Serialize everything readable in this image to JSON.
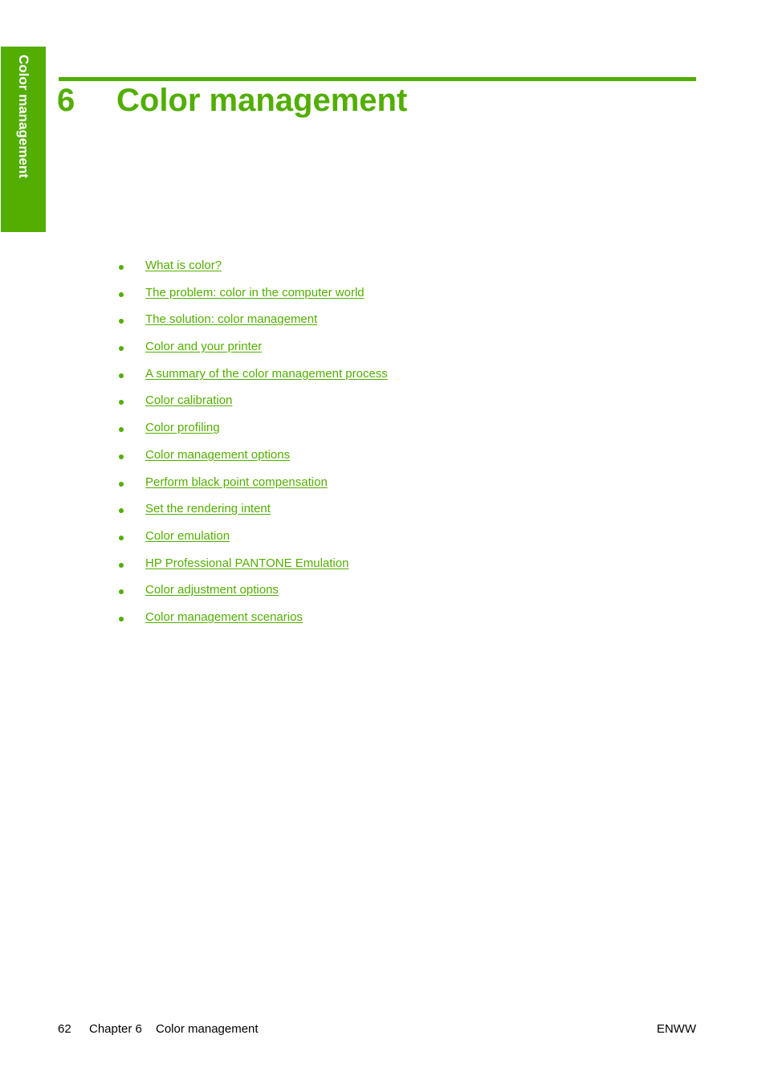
{
  "theme": {
    "accent": "#52ae00",
    "text": "#000000"
  },
  "side_tab": {
    "label": "Color management"
  },
  "header": {
    "chapter_number": "6",
    "chapter_title": "Color management"
  },
  "toc": {
    "items": [
      {
        "label": "What is color?"
      },
      {
        "label": "The problem: color in the computer world"
      },
      {
        "label": "The solution: color management"
      },
      {
        "label": "Color and your printer"
      },
      {
        "label": "A summary of the color management process"
      },
      {
        "label": "Color calibration"
      },
      {
        "label": "Color profiling"
      },
      {
        "label": "Color management options"
      },
      {
        "label": "Perform black point compensation"
      },
      {
        "label": "Set the rendering intent"
      },
      {
        "label": "Color emulation"
      },
      {
        "label": "HP Professional PANTONE Emulation"
      },
      {
        "label": "Color adjustment options"
      },
      {
        "label": "Color management scenarios"
      }
    ]
  },
  "footer": {
    "page_number": "62",
    "chapter_label": "Chapter 6",
    "chapter_title": "Color management",
    "locale_code": "ENWW"
  }
}
